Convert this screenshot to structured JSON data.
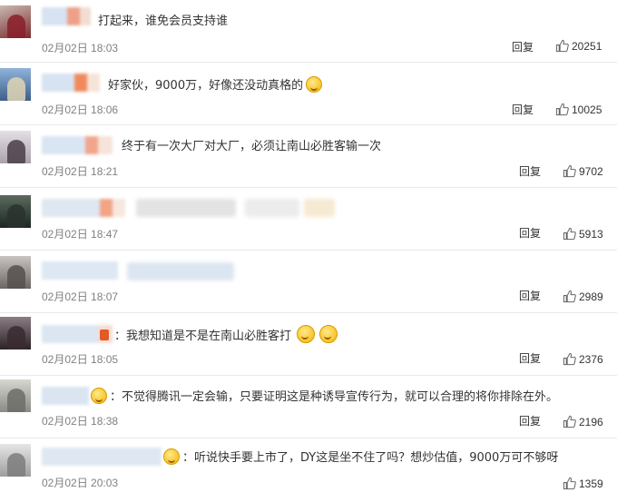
{
  "comments": [
    {
      "text": "打起来，谁免会员支持谁",
      "date": "02月02日 18:03",
      "reply": "回复",
      "likes": "20251",
      "emoji": []
    },
    {
      "text": "好家伙，9000万，好像还没动真格的",
      "date": "02月02日 18:06",
      "reply": "回复",
      "likes": "10025",
      "emoji": [
        "smirk-emoji-icon"
      ]
    },
    {
      "text": "终于有一次大厂对大厂，必须让南山必胜客输一次",
      "date": "02月02日 18:21",
      "reply": "回复",
      "likes": "9702",
      "emoji": []
    },
    {
      "text": "",
      "date": "02月02日 18:47",
      "reply": "回复",
      "likes": "5913",
      "emoji": []
    },
    {
      "text": "",
      "date": "02月02日 18:07",
      "reply": "回复",
      "likes": "2989",
      "emoji": []
    },
    {
      "text": "：我想知道是不是在南山必胜客打",
      "date": "02月02日 18:05",
      "reply": "回复",
      "likes": "2376",
      "emoji": [
        "grin-emoji-icon",
        "grin-emoji-icon"
      ]
    },
    {
      "text": "：不觉得腾讯一定会输，只要证明这是种诱导宣传行为，就可以合理的将你排除在外。",
      "date": "02月02日 18:38",
      "reply": "回复",
      "likes": "2196",
      "emoji": []
    },
    {
      "text": "：听说快手要上市了，DY这是坐不住了吗？想炒估值，9000万可不够呀",
      "date": "02月02日 20:03",
      "reply": "回复",
      "likes": "1359",
      "emoji": []
    }
  ],
  "icons": {
    "like": "thumbs-up-icon",
    "avatar": "avatar-blurred"
  },
  "colors": {
    "text": "#333333",
    "meta": "#808080",
    "divider": "#e9e9e9"
  }
}
